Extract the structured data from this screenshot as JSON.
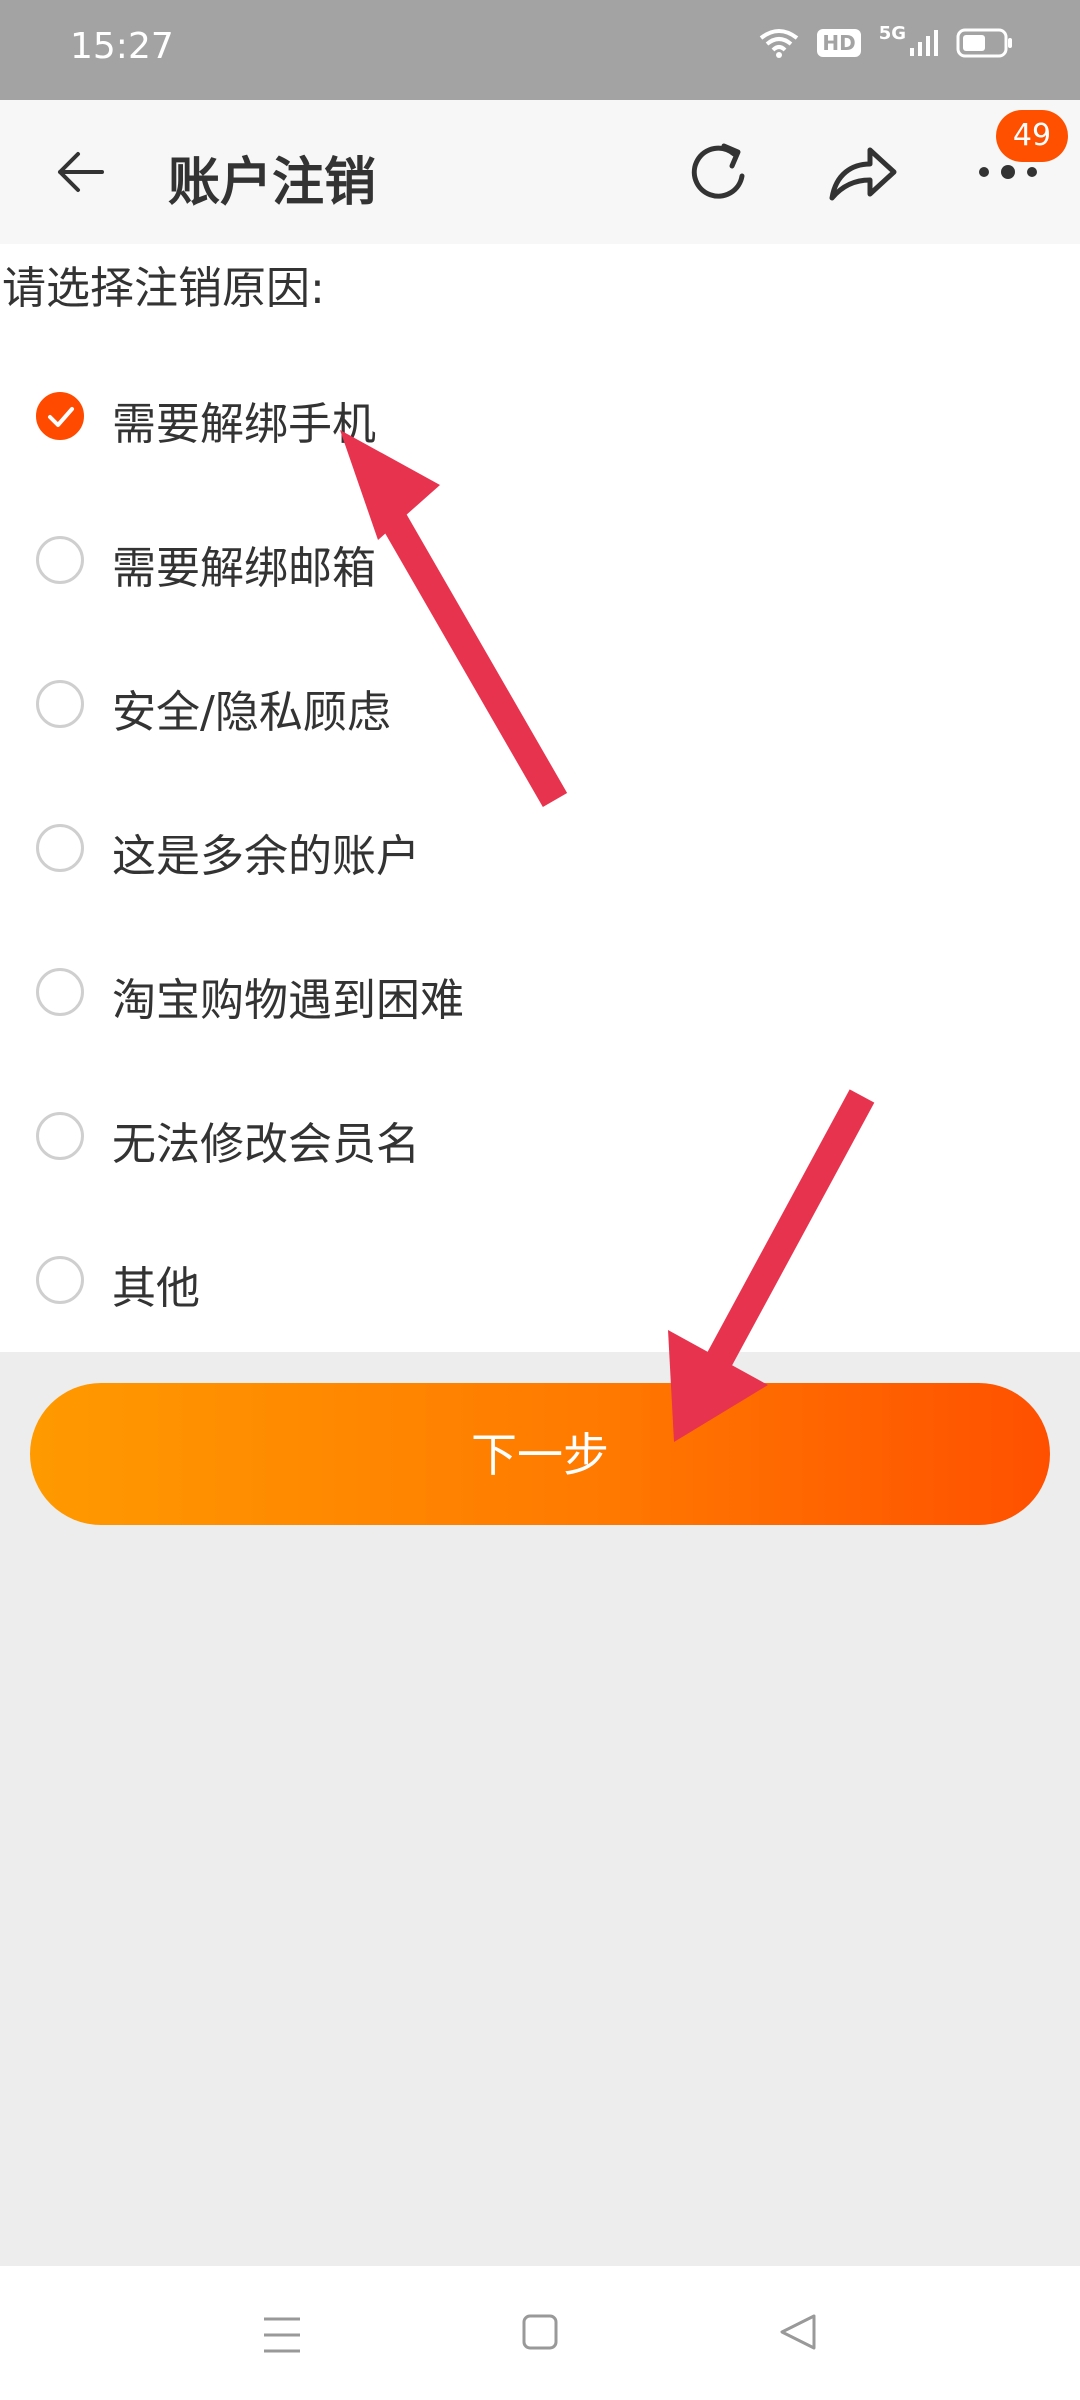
{
  "status": {
    "time": "15:27",
    "hd": "HD",
    "network": "5G"
  },
  "nav": {
    "title": "账户注销",
    "badge_count": "49"
  },
  "form": {
    "prompt": "请选择注销原因:",
    "options": [
      {
        "label": "需要解绑手机",
        "checked": true
      },
      {
        "label": "需要解绑邮箱",
        "checked": false
      },
      {
        "label": "安全/隐私顾虑",
        "checked": false
      },
      {
        "label": "这是多余的账户",
        "checked": false
      },
      {
        "label": "淘宝购物遇到困难",
        "checked": false
      },
      {
        "label": "无法修改会员名",
        "checked": false
      },
      {
        "label": "其他",
        "checked": false
      }
    ],
    "next_label": "下一步"
  },
  "colors": {
    "accent": "#ff5000",
    "annotation_arrow": "#e8334f"
  },
  "icons": [
    "back-arrow-icon",
    "refresh-icon",
    "share-icon",
    "more-icon",
    "check-icon",
    "menu-icon",
    "home-icon",
    "back-triangle-icon"
  ]
}
